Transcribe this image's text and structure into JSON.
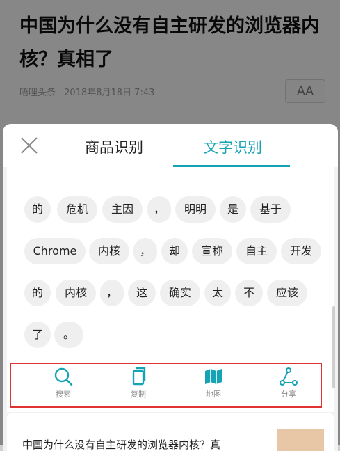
{
  "article": {
    "title": "中国为什么没有自主研发的浏览器内核？真相了",
    "source": "唔哩头条",
    "date": "2018年8月18日 7:43",
    "font_button": "AA"
  },
  "sheet": {
    "tabs": [
      {
        "label": "商品识别",
        "active": false
      },
      {
        "label": "文字识别",
        "active": true
      }
    ],
    "accent_color": "#15a3b5",
    "words": [
      "的",
      "危机",
      "主因",
      "，",
      "明明",
      "是",
      "基于",
      "Chrome",
      "内核",
      "，",
      "却",
      "宣称",
      "自主",
      "开发",
      "的",
      "内核",
      "，",
      "这",
      "确实",
      "太",
      "不",
      "应该",
      "了",
      "。"
    ],
    "toolbar": [
      {
        "icon": "search-icon",
        "label": "搜索"
      },
      {
        "icon": "copy-icon",
        "label": "复制"
      },
      {
        "icon": "map-icon",
        "label": "地图"
      },
      {
        "icon": "share-icon",
        "label": "分享"
      }
    ],
    "highlight_color": "#e23333"
  },
  "preview": {
    "title": "中国为什么没有自主研发的浏览器内核？真"
  }
}
